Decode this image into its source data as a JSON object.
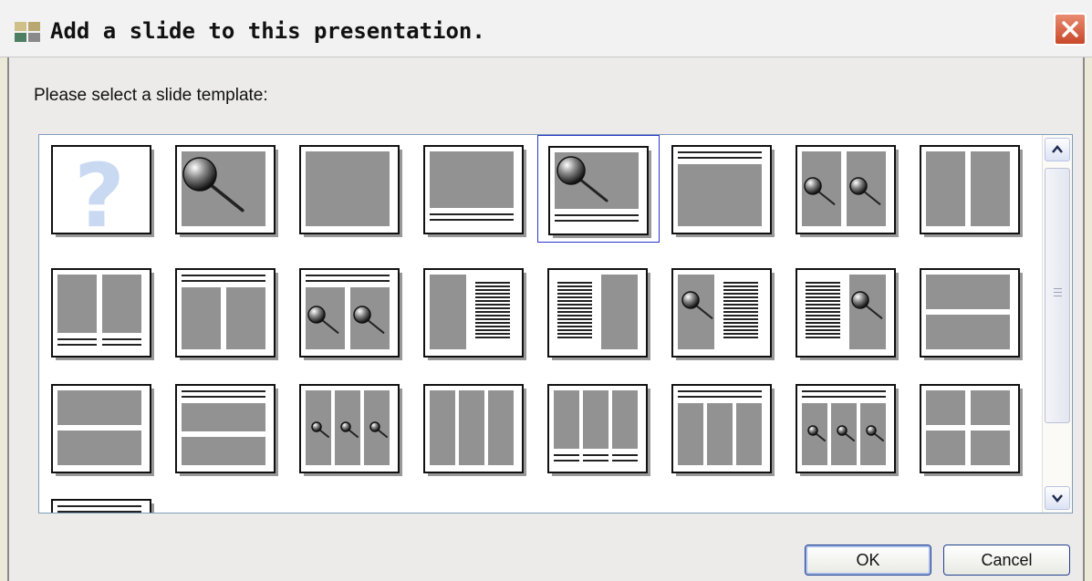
{
  "window": {
    "title": "Add a slide to this presentation.",
    "close_icon": "close-icon"
  },
  "prompt": "Please select a slide template:",
  "templates": [
    {
      "id": "blank-question",
      "icon": "question-mark-icon",
      "selected": false
    },
    {
      "id": "single-image-magnifier",
      "icon": "magnifier-image-icon",
      "selected": false
    },
    {
      "id": "single-content",
      "icon": "content-block-icon",
      "selected": false
    },
    {
      "id": "content-with-caption-below",
      "icon": "content-caption-icon",
      "selected": false
    },
    {
      "id": "image-with-caption-below",
      "icon": "magnifier-caption-icon",
      "selected": true
    },
    {
      "id": "title-with-content",
      "icon": "title-content-icon",
      "selected": false
    },
    {
      "id": "two-images",
      "icon": "two-magnifier-icon",
      "selected": false
    },
    {
      "id": "two-columns",
      "icon": "two-columns-icon",
      "selected": false
    },
    {
      "id": "two-columns-with-captions",
      "icon": "two-columns-caption-icon",
      "selected": false
    },
    {
      "id": "title-two-columns",
      "icon": "title-two-columns-icon",
      "selected": false
    },
    {
      "id": "title-two-images",
      "icon": "title-two-magnifier-icon",
      "selected": false
    },
    {
      "id": "content-left-text-right",
      "icon": "content-text-icon",
      "selected": false
    },
    {
      "id": "text-left-content-right",
      "icon": "text-content-icon",
      "selected": false
    },
    {
      "id": "image-left-text-right",
      "icon": "magnifier-text-icon",
      "selected": false
    },
    {
      "id": "text-left-image-right",
      "icon": "text-magnifier-icon",
      "selected": false
    },
    {
      "id": "two-rows",
      "icon": "two-rows-icon",
      "selected": false
    },
    {
      "id": "two-rows-alt",
      "icon": "two-rows-alt-icon",
      "selected": false
    },
    {
      "id": "title-two-rows",
      "icon": "title-two-rows-icon",
      "selected": false
    },
    {
      "id": "three-images",
      "icon": "three-magnifier-icon",
      "selected": false
    },
    {
      "id": "three-columns",
      "icon": "three-columns-icon",
      "selected": false
    },
    {
      "id": "three-columns-with-captions",
      "icon": "three-columns-caption-icon",
      "selected": false
    },
    {
      "id": "title-three-columns",
      "icon": "title-three-columns-icon",
      "selected": false
    },
    {
      "id": "title-three-images",
      "icon": "title-three-magnifier-icon",
      "selected": false
    },
    {
      "id": "four-grid",
      "icon": "four-grid-icon",
      "selected": false
    },
    {
      "id": "title-only-partial",
      "icon": "title-only-icon",
      "selected": false
    }
  ],
  "scrollbar": {
    "up_icon": "chevron-up-icon",
    "down_icon": "chevron-down-icon"
  },
  "buttons": {
    "ok_label": "OK",
    "cancel_label": "Cancel"
  }
}
